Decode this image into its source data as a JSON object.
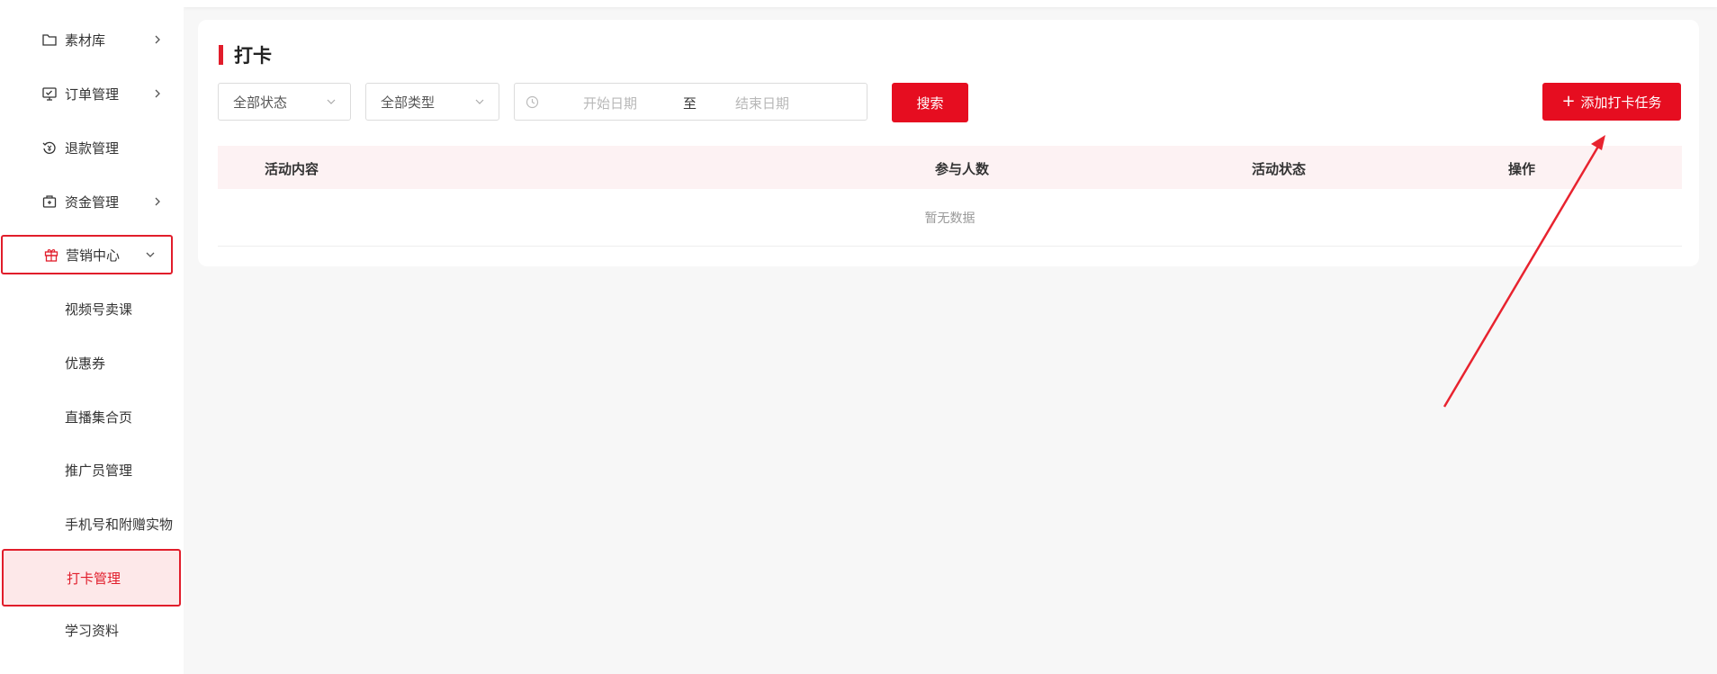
{
  "sidebar": {
    "items": [
      {
        "label": "素材库",
        "icon": "folder-icon",
        "has_children": true
      },
      {
        "label": "订单管理",
        "icon": "monitor-icon",
        "has_children": true
      },
      {
        "label": "退款管理",
        "icon": "refund-icon",
        "has_children": false
      },
      {
        "label": "资金管理",
        "icon": "wallet-icon",
        "has_children": true
      },
      {
        "label": "营销中心",
        "icon": "gift-icon",
        "has_children": true,
        "expanded": true
      },
      {
        "label": "视频号卖课"
      },
      {
        "label": "优惠券"
      },
      {
        "label": "直播集合页"
      },
      {
        "label": "推广员管理"
      },
      {
        "label": "手机号和附赠实物"
      },
      {
        "label": "打卡管理",
        "active": true
      },
      {
        "label": "学习资料"
      }
    ]
  },
  "page": {
    "title": "打卡"
  },
  "filters": {
    "status": "全部状态",
    "type": "全部类型",
    "start_placeholder": "开始日期",
    "range_sep": "至",
    "end_placeholder": "结束日期",
    "search_label": "搜索",
    "add_label": "添加打卡任务",
    "add_icon": "plus-icon"
  },
  "table": {
    "columns": [
      "活动内容",
      "参与人数",
      "活动状态",
      "操作"
    ],
    "empty_text": "暂无数据"
  },
  "colors": {
    "accent": "#e60d20",
    "highlight": "#e11d2b",
    "header_bg": "#fdf2f3"
  }
}
